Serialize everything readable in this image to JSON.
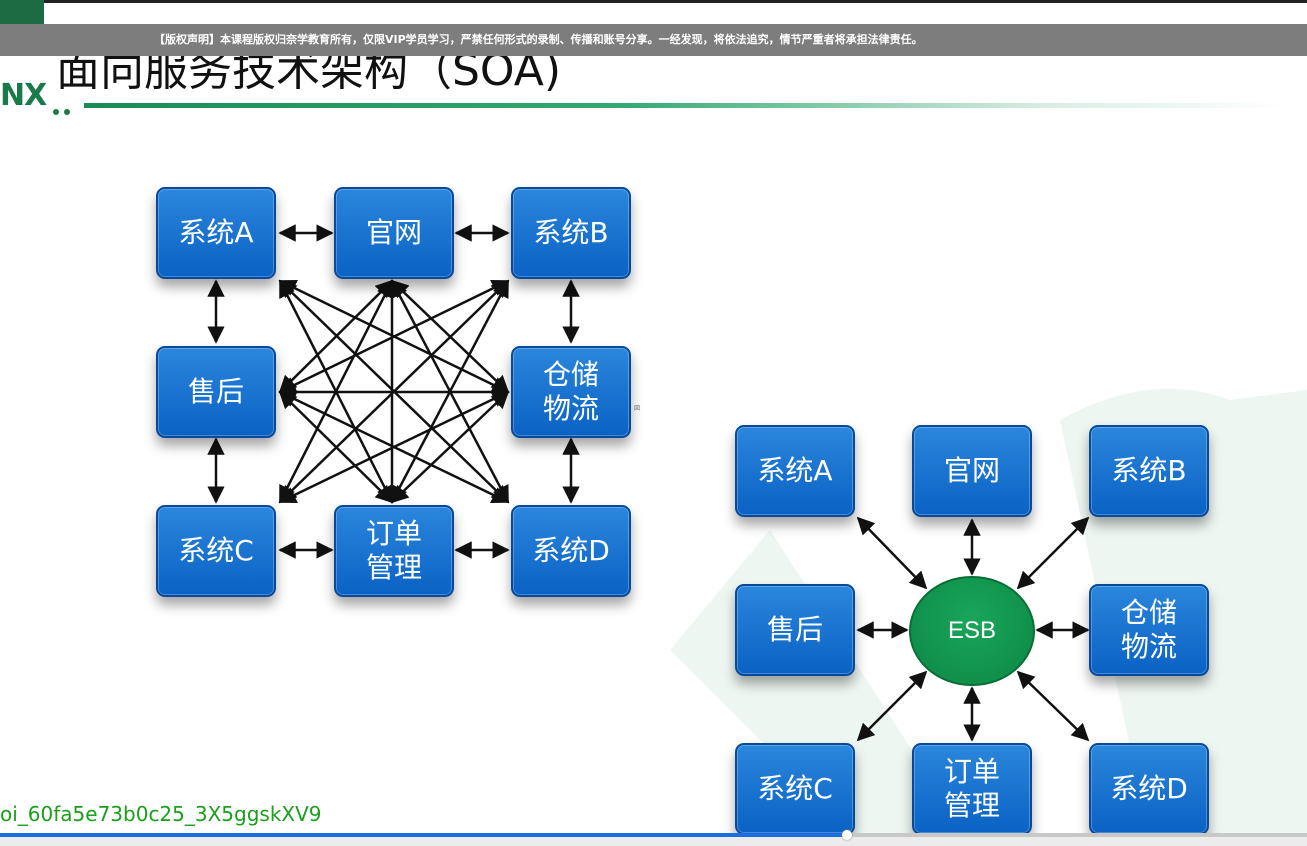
{
  "notice": "【版权声明】本课程版权归奈学教育所有，仅限VIP学员学习，严禁任何形式的录制、传播和账号分享。一经发现，将依法追究，情节严重者将承担法律责任。",
  "logo": {
    "text": "NX"
  },
  "slide": {
    "title": "面向服务技术架构（SOA)",
    "left_diagram": {
      "nodes": {
        "sys_a": "系统A",
        "website": "官网",
        "sys_b": "系统B",
        "aftersale": "售后",
        "warehouse_l1": "仓储",
        "warehouse_l2": "物流",
        "sys_c": "系统C",
        "order_l1": "订单",
        "order_l2": "管理",
        "sys_d": "系统D"
      }
    },
    "right_diagram": {
      "hub": "ESB",
      "nodes": {
        "sys_a": "系统A",
        "website": "官网",
        "sys_b": "系统B",
        "aftersale": "售后",
        "warehouse_l1": "仓储",
        "warehouse_l2": "物流",
        "sys_c": "系统C",
        "order_l1": "订单",
        "order_l2": "管理",
        "sys_d": "系统D"
      }
    },
    "tiny_mark": "図"
  },
  "watermark": "oi_60fa5e73b0c25_3X5ggskXV9",
  "player": {
    "progress": 0.648
  },
  "colors": {
    "node": "#0a62c4",
    "esb": "#0c8744",
    "accent": "#1c8a55"
  }
}
